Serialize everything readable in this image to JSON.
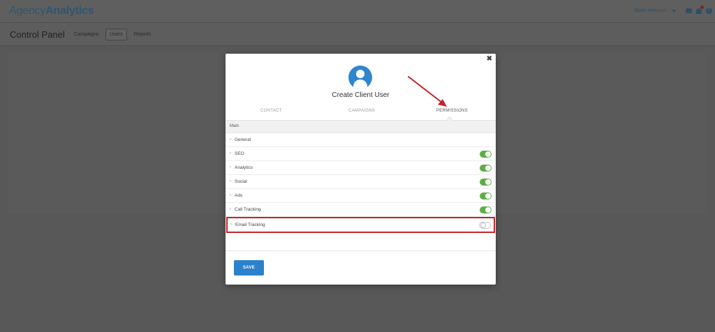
{
  "header": {
    "logo_part1": "Agency",
    "logo_part2": "Analytics",
    "user_name": "Blake Atkinson"
  },
  "subheader": {
    "title": "Control Panel",
    "tabs": [
      {
        "label": "Campaigns",
        "active": false
      },
      {
        "label": "Users",
        "active": true
      },
      {
        "label": "Reports",
        "active": false
      }
    ]
  },
  "modal": {
    "close_symbol": "✖",
    "title": "Create Client User",
    "tabs": [
      {
        "label": "CONTACT"
      },
      {
        "label": "CAMPAIGNS"
      },
      {
        "label": "PERMISSIONS",
        "active": true
      }
    ],
    "section_header": "Main",
    "permissions": [
      {
        "label": "General",
        "toggle": null
      },
      {
        "label": "SEO",
        "toggle": true
      },
      {
        "label": "Analytics",
        "toggle": true
      },
      {
        "label": "Social",
        "toggle": true
      },
      {
        "label": "Ads",
        "toggle": true
      },
      {
        "label": "Call Tracking",
        "toggle": true
      },
      {
        "label": "Email Tracking",
        "toggle": false,
        "highlighted": true
      }
    ],
    "save_label": "SAVE"
  },
  "colors": {
    "accent": "#2b82cb",
    "toggle_on": "#5fae45",
    "annotation": "#c3252b"
  }
}
